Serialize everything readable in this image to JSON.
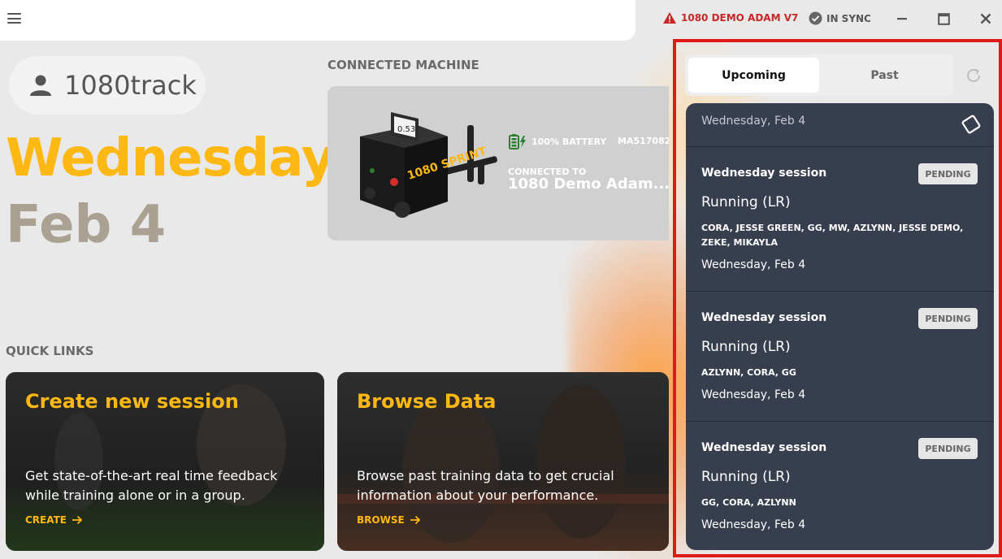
{
  "window": {
    "device_label": "1080 DEMO ADAM V7",
    "sync_label": "IN SYNC"
  },
  "profile": {
    "name": "1080track"
  },
  "hero": {
    "day": "Wednesday",
    "date": "Feb 4"
  },
  "connected_machine": {
    "section_label": "CONNECTED MACHINE",
    "screen_value": "0.53",
    "brand_mark": "1080 SPRINT",
    "battery": "100% BATTERY",
    "serial": "MA517082",
    "connected_to_label": "CONNECTED TO",
    "connected_name": "1080 Demo Adam..."
  },
  "quick_links": {
    "section_label": "QUICK LINKS",
    "cards": [
      {
        "title": "Create new session",
        "description": "Get state-of-the-art real time feedback while training alone or in a group.",
        "link": "CREATE"
      },
      {
        "title": "Browse Data",
        "description": "Browse past training data to get crucial information about your performance.",
        "link": "BROWSE"
      }
    ]
  },
  "sessions_panel": {
    "tabs": [
      "Upcoming",
      "Past"
    ],
    "active_tab": "Upcoming",
    "header_date": "Wednesday, Feb 4",
    "sessions": [
      {
        "title": "Wednesday session",
        "status": "PENDING",
        "type": "Running (LR)",
        "users": "CORA, JESSE GREEN, GG, MW, AZLYNN, JESSE DEMO, ZEKE, MIKAYLA",
        "date": "Wednesday, Feb 4"
      },
      {
        "title": "Wednesday session",
        "status": "PENDING",
        "type": "Running (LR)",
        "users": "AZLYNN, CORA, GG",
        "date": "Wednesday, Feb 4"
      },
      {
        "title": "Wednesday session",
        "status": "PENDING",
        "type": "Running (LR)",
        "users": "GG, CORA, AZLYNN",
        "date": "Wednesday, Feb 4"
      }
    ]
  },
  "colors": {
    "accent": "#fdb813",
    "warning": "#c62828",
    "panel": "#373e4e",
    "highlight_frame": "#e01919"
  }
}
